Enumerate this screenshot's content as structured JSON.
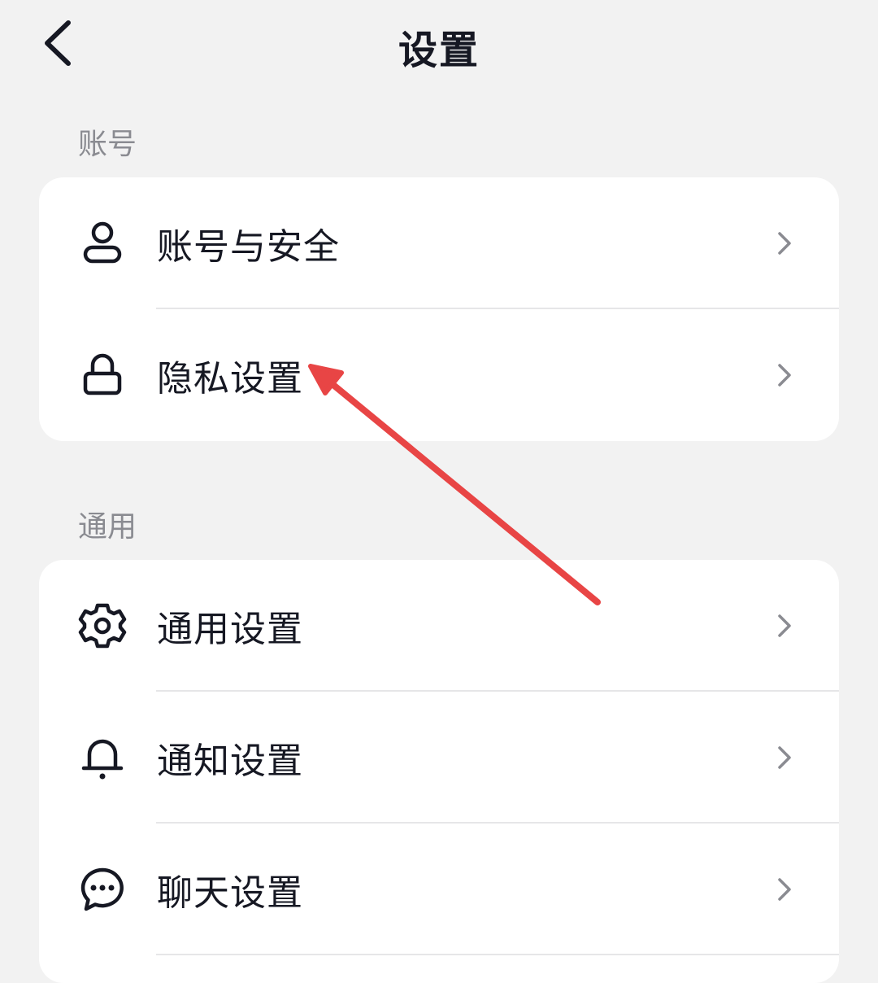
{
  "header": {
    "title": "设置",
    "back_icon": "chevron-left-icon"
  },
  "sections": [
    {
      "label": "账号",
      "items": [
        {
          "label": "账号与安全",
          "icon": "user-icon"
        },
        {
          "label": "隐私设置",
          "icon": "lock-icon"
        }
      ]
    },
    {
      "label": "通用",
      "items": [
        {
          "label": "通用设置",
          "icon": "gear-icon"
        },
        {
          "label": "通知设置",
          "icon": "bell-icon"
        },
        {
          "label": "聊天设置",
          "icon": "chat-icon"
        }
      ]
    }
  ],
  "colors": {
    "background": "#f2f2f2",
    "card": "#ffffff",
    "text_primary": "#161823",
    "text_secondary": "#8a8b91",
    "chevron": "#8a8b91",
    "annotation_arrow": "#e84545"
  }
}
